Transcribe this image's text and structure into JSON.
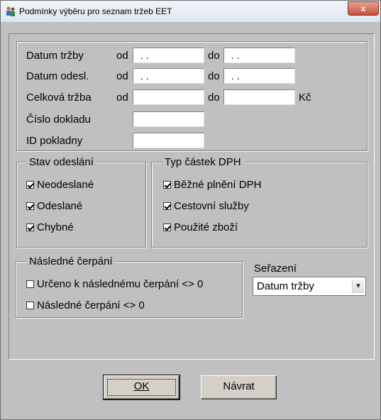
{
  "window": {
    "title": "Podmínky výběru pro seznam tržeb EET",
    "icon": "app-people-icon",
    "close_glyph": "x"
  },
  "filters": {
    "datum_trzby": {
      "label": "Datum tržby",
      "from_label": "od",
      "to_label": "do",
      "from_value": " . .",
      "to_value": " . ."
    },
    "datum_odesl": {
      "label": "Datum odesl.",
      "from_label": "od",
      "to_label": "do",
      "from_value": " . .",
      "to_value": " . ."
    },
    "celkova_trzba": {
      "label": "Celková tržba",
      "from_label": "od",
      "to_label": "do",
      "from_value": "",
      "to_value": "",
      "unit": "Kč"
    },
    "cislo_dokladu": {
      "label": "Číslo dokladu",
      "value": ""
    },
    "id_pokladny": {
      "label": "ID pokladny",
      "value": ""
    }
  },
  "stav_odeslani": {
    "title": "Stav odeslání",
    "items": [
      {
        "label": "Neodeslané",
        "checked": true
      },
      {
        "label": "Odeslané",
        "checked": true
      },
      {
        "label": "Chybné",
        "checked": true
      }
    ]
  },
  "typ_castek": {
    "title": "Typ částek DPH",
    "items": [
      {
        "label": "Běžné plnění DPH",
        "checked": true
      },
      {
        "label": "Cestovní služby",
        "checked": true
      },
      {
        "label": "Použité zboží",
        "checked": true
      }
    ]
  },
  "nasledne_cerpani": {
    "title": "Následné čerpání",
    "items": [
      {
        "label": "Určeno k následnému čerpání <> 0",
        "checked": false
      },
      {
        "label": "Následné čerpání <> 0",
        "checked": false
      }
    ]
  },
  "serazeni": {
    "label": "Seřazení",
    "selected": "Datum tržby"
  },
  "buttons": {
    "ok": "OK",
    "navrat": "Návrat"
  }
}
